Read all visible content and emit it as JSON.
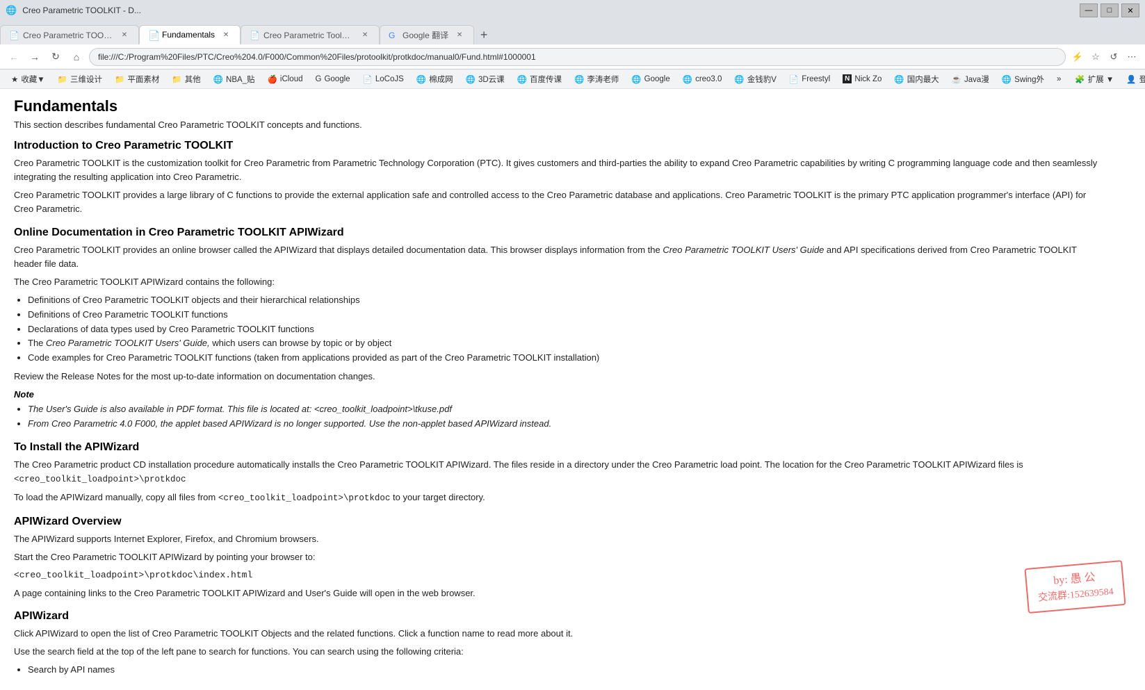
{
  "browser": {
    "title_bar": {
      "title": "Creo Parametric TOOLKIT - D...",
      "controls": [
        "—",
        "□",
        "✕"
      ]
    },
    "tabs": [
      {
        "id": "tab1",
        "label": "Creo Parametric TOOLKIT - D...",
        "active": false,
        "favicon": "doc"
      },
      {
        "id": "tab2",
        "label": "Fundamentals",
        "active": true,
        "favicon": "doc-green"
      },
      {
        "id": "tab3",
        "label": "Creo Parametric Toolkit - HTM...",
        "active": false,
        "favicon": "doc"
      },
      {
        "id": "tab4",
        "label": "Google 翻译",
        "active": false,
        "favicon": "google"
      }
    ],
    "address": "file:///C:/Program%20Files/PTC/Creo%204.0/F000/Common%20Files/protoolkit/protkdoc/manual0/Fund.html#1000001",
    "bookmarks": [
      {
        "label": "收藏▼",
        "icon": "★"
      },
      {
        "label": "三维设计",
        "icon": "📁"
      },
      {
        "label": "平面素材",
        "icon": "📁"
      },
      {
        "label": "其他",
        "icon": "📁"
      },
      {
        "label": "NBA_贴",
        "icon": "🌐"
      },
      {
        "label": "iCloud",
        "icon": "🍎"
      },
      {
        "label": "Google",
        "icon": "🌐"
      },
      {
        "label": "LoCoJS",
        "icon": "📄"
      },
      {
        "label": "棉成网",
        "icon": "🌐"
      },
      {
        "label": "3D云课",
        "icon": "🌐"
      },
      {
        "label": "百度传课",
        "icon": "🌐"
      },
      {
        "label": "李涛老师",
        "icon": "🌐"
      },
      {
        "label": "Google",
        "icon": "🌐"
      },
      {
        "label": "creo3.0",
        "icon": "🌐"
      },
      {
        "label": "金钱豹V",
        "icon": "🌐"
      },
      {
        "label": "Freestyl",
        "icon": "📄"
      },
      {
        "label": "Nick Zo",
        "icon": "N"
      },
      {
        "label": "国内最大",
        "icon": "🌐"
      },
      {
        "label": "Java漫",
        "icon": "☕"
      },
      {
        "label": "Swing外",
        "icon": "🌐"
      },
      {
        "label": "»",
        "icon": ""
      },
      {
        "label": "扩展 ▼",
        "icon": ""
      },
      {
        "label": "登录管家",
        "icon": "👤"
      }
    ]
  },
  "page": {
    "title": "Fundamentals",
    "intro": "This section describes fundamental Creo Parametric TOOLKIT concepts and functions.",
    "sections": [
      {
        "id": "intro-section",
        "heading": "Introduction to Creo Parametric TOOLKIT",
        "paragraphs": [
          "Creo Parametric TOOLKIT is the customization toolkit for Creo Parametric from Parametric Technology Corporation (PTC). It gives customers and third-parties the ability to expand Creo Parametric capabilities by writing C programming language code and then seamlessly integrating the resulting application into Creo Parametric.",
          "Creo Parametric TOOLKIT provides a large library of C functions to provide the external application safe and controlled access to the Creo Parametric database and applications. Creo Parametric TOOLKIT is the primary PTC application programmer's interface (API) for Creo Parametric."
        ]
      },
      {
        "id": "online-doc-section",
        "heading": "Online Documentation in Creo Parametric TOOLKIT APIWizard",
        "paragraphs": [
          "Creo Parametric TOOLKIT provides an online browser called the APIWizard that displays detailed documentation data. This browser displays information from the Creo Parametric TOOLKIT Users' Guide and API specifications derived from Creo Parametric TOOLKIT header file data.",
          "The Creo Parametric TOOLKIT APIWizard contains the following:"
        ],
        "list": [
          {
            "text": "Definitions of Creo Parametric TOOLKIT objects and their hierarchical relationships",
            "italic": false
          },
          {
            "text": "Definitions of Creo Parametric TOOLKIT functions",
            "italic": false
          },
          {
            "text": "Declarations of data types used by Creo Parametric TOOLKIT functions",
            "italic": false
          },
          {
            "text": "The Creo Parametric TOOLKIT Users' Guide, which users can browse by topic or by object",
            "italic": true,
            "italic_part": "Creo Parametric TOOLKIT Users' Guide,"
          },
          {
            "text": "Code examples for Creo Parametric TOOLKIT functions (taken from applications provided as part of the Creo Parametric TOOLKIT installation)",
            "italic": false
          }
        ],
        "after_list": "Review the Release Notes for the most up-to-date information on documentation changes.",
        "note_label": "Note",
        "note_items": [
          {
            "text": "The User's Guide is also available in PDF format. This file is located at: <creo_toolkit_loadpoint>\\tkuse.pdf",
            "italic": true
          },
          {
            "text": "From Creo Parametric 4.0 F000, the applet based APIWizard is no longer supported. Use the non-applet based APIWizard instead.",
            "italic": true
          }
        ]
      },
      {
        "id": "install-section",
        "heading": "To Install the APIWizard",
        "paragraphs": [
          "The Creo Parametric product CD installation procedure automatically installs the Creo Parametric TOOLKIT APIWizard. The files reside in a directory under the Creo Parametric load point. The location for the Creo Parametric TOOLKIT APIWizard files is <creo_toolkit_loadpoint>\\protkdoc",
          "To load the APIWizard manually, copy all files from <creo_toolkit_loadpoint>\\protkdoc to your target directory."
        ]
      },
      {
        "id": "overview-section",
        "heading": "APIWizard Overview",
        "paragraphs": [
          "The APIWizard supports Internet Explorer, Firefox, and Chromium browsers.",
          "Start the Creo Parametric TOOLKIT APIWizard by pointing your browser to:",
          "<creo_toolkit_loadpoint>\\protkdoc\\index.html",
          "A page containing links to the Creo Parametric TOOLKIT APIWizard and User's Guide will open in the web browser."
        ]
      },
      {
        "id": "apiwizard-section",
        "heading": "APIWizard",
        "paragraphs": [
          "Click APIWizard to open the list of Creo Parametric TOOLKIT Objects and the related functions. Click a function name to read more about it.",
          "Use the search field at the top of the left pane to search for functions. You can search using the following criteria:"
        ],
        "list": [
          {
            "text": "Search by API names",
            "italic": false
          }
        ]
      }
    ]
  },
  "stamp": {
    "line1": "by: 愚 公",
    "line2": "交流群:152639584"
  }
}
